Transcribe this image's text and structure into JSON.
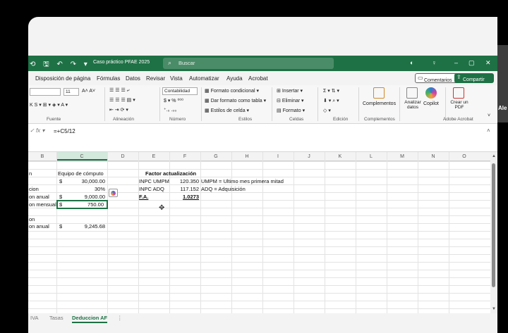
{
  "title_bar": {
    "filename": "Caso práctico PFAE 2025",
    "search_placeholder": "Buscar"
  },
  "menu": [
    "Disposición de página",
    "Fórmulas",
    "Datos",
    "Revisar",
    "Vista",
    "Automatizar",
    "Ayuda",
    "Acrobat"
  ],
  "buttons": {
    "comments": "Comentarios",
    "share": "Compartir"
  },
  "ribbon": {
    "font_size": "11",
    "number_format": "Contabilidad",
    "styles": [
      "Formato condicional",
      "Dar formato como tabla",
      "Estilos de celda"
    ],
    "cells": [
      "Insertar",
      "Eliminar",
      "Formato"
    ],
    "complementos": "Complementos",
    "analizar": "Analizar datos",
    "copilot": "Copilot",
    "crear_pdf": "Crear un PDF",
    "groups": [
      "Fuente",
      "Alineación",
      "Número",
      "Estilos",
      "Celdas",
      "Edición",
      "Complementos",
      "Adobe Acrobat"
    ]
  },
  "formula_bar": {
    "fx": "fx",
    "formula": "=+C5/12"
  },
  "columns": [
    "B",
    "C",
    "D",
    "E",
    "F",
    "G",
    "H",
    "I",
    "J",
    "K",
    "L",
    "M",
    "N",
    "O"
  ],
  "cells": {
    "b3": "n",
    "b5": "cion",
    "b6": "on anual",
    "b7": "on mensual",
    "b9": "on",
    "b10": "on anual",
    "c3": "Equipo de cómputo",
    "c4_cur": "$",
    "c4": "30,000.00",
    "c5": "30%",
    "c6_cur": "$",
    "c6": "9,000.00",
    "c7_cur": "$",
    "c7": "750.00",
    "c10_cur": "$",
    "c10": "9,245.68",
    "e3": "Factor actualización",
    "e4": "INPC UMPM",
    "f4": "120.350",
    "g4": "UMPM = Ultimo mes primera mitad",
    "e5": "INPC ADQ",
    "f5": "117.152",
    "g5": "ADQ = Adquisición",
    "e6": "F.A.",
    "f6": "1.0273"
  },
  "sheet_tabs": [
    "IVA",
    "Tasas",
    "Deduccion AF"
  ],
  "side_text": "Ale"
}
